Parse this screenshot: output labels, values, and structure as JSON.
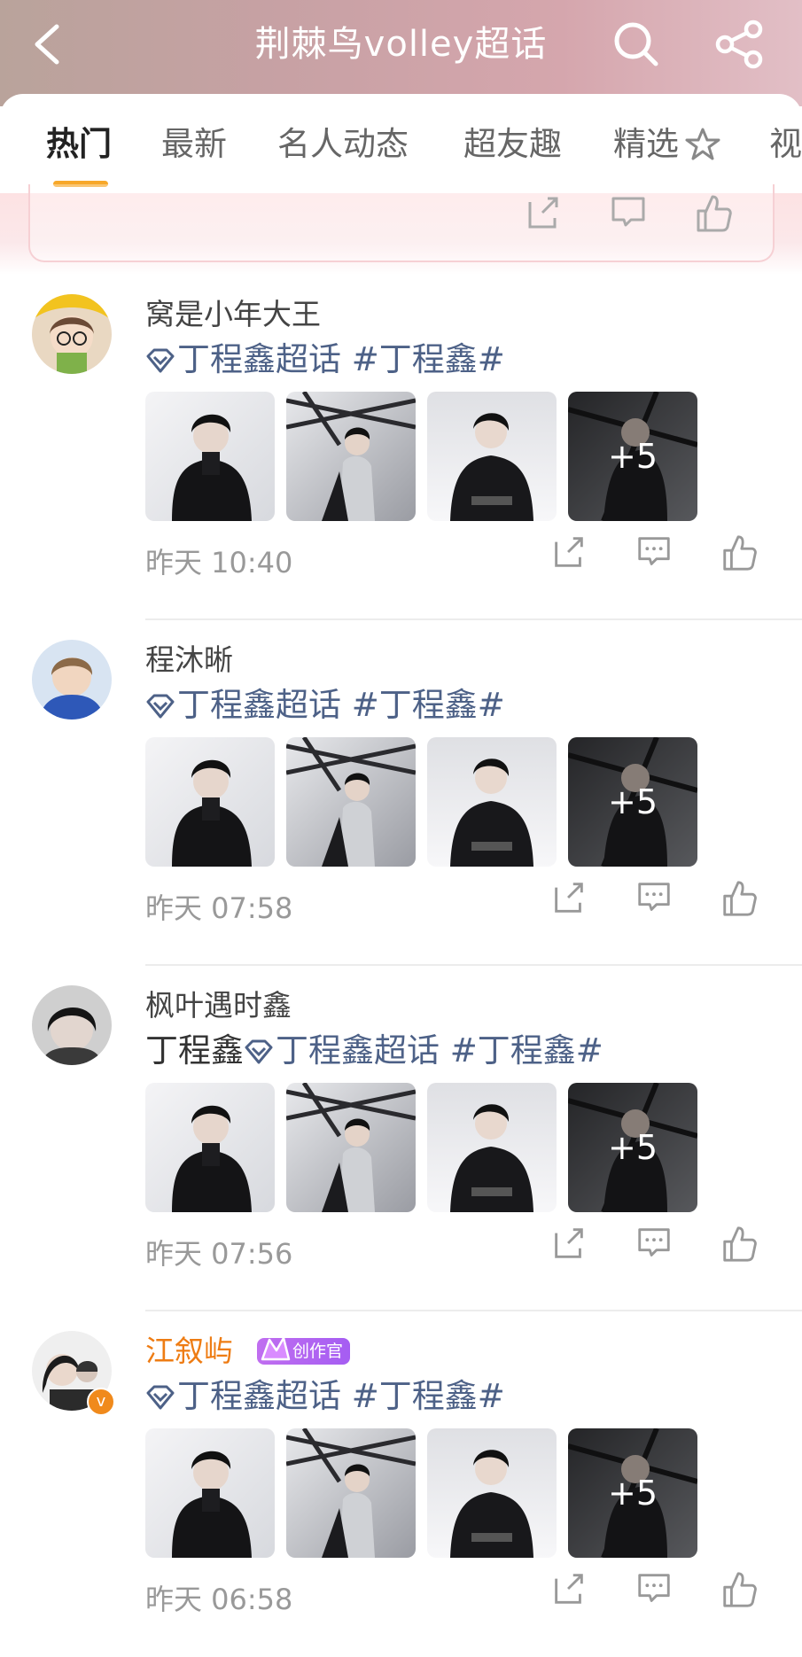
{
  "header": {
    "title": "荆棘鸟volley超话",
    "back_icon": "back-chevron-icon",
    "search_icon": "search-icon",
    "share_icon": "share-icon"
  },
  "tabs": [
    {
      "label": "热门",
      "active": true
    },
    {
      "label": "最新"
    },
    {
      "label": "名人动态"
    },
    {
      "label": "超友趣"
    },
    {
      "label": "精选"
    },
    {
      "label": "视"
    }
  ],
  "colors": {
    "accent": "#f7a82a",
    "topic": "#4d6187",
    "creator_name": "#ee7c13",
    "creator_badge": "#b066f0"
  },
  "posts": [
    {
      "username": "窝是小年大王",
      "prefix": "",
      "topic": "丁程鑫超话",
      "hashtag": "#丁程鑫#",
      "more_count": "+5",
      "time": "昨天 10:40"
    },
    {
      "username": "程沐晰",
      "prefix": "",
      "topic": "丁程鑫超话",
      "hashtag": "#丁程鑫#",
      "more_count": "+5",
      "time": "昨天 07:58"
    },
    {
      "username": "枫叶遇时鑫",
      "prefix": "丁程鑫",
      "topic": "丁程鑫超话",
      "hashtag": "#丁程鑫#",
      "more_count": "+5",
      "time": "昨天 07:56"
    },
    {
      "username": "江叙屿",
      "badge": "创作官",
      "verified": true,
      "prefix": "",
      "topic": "丁程鑫超话",
      "hashtag": "#丁程鑫#",
      "more_count": "+5",
      "time": "昨天 06:58"
    }
  ]
}
